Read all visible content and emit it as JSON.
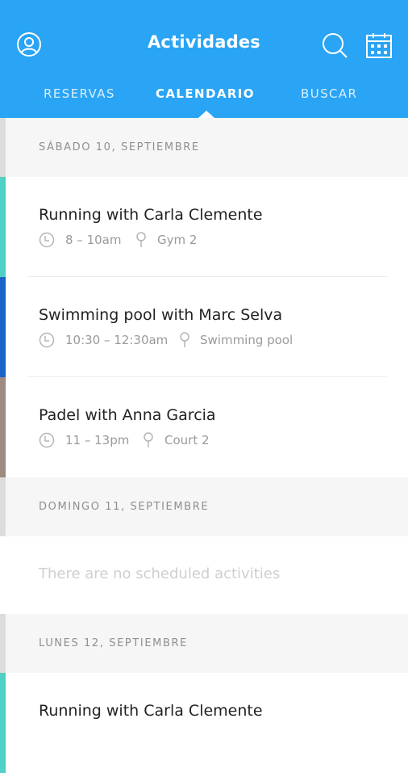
{
  "header": {
    "title": "Actividades",
    "icons": [
      "profile-icon",
      "search-icon",
      "calendar-icon"
    ]
  },
  "tabs": [
    {
      "label": "RESERVAS",
      "active": false
    },
    {
      "label": "CALENDARIO",
      "active": true
    },
    {
      "label": "BUSCAR",
      "active": false
    }
  ],
  "days": [
    {
      "label": "SÁBADO 10, SEPTIEMBRE",
      "activities": [
        {
          "name_prefix": "Running with ",
          "instructor": "Carla Clemente",
          "time": "8 – 10am",
          "place": "Gym 2",
          "color": "#4fd1c5"
        },
        {
          "name_prefix": "Swimming pool with ",
          "instructor": "Marc Selva",
          "time": "10:30 – 12:30am",
          "place": "Swimming pool",
          "color": "#1a63c7"
        },
        {
          "name_prefix": "Padel with ",
          "instructor": "Anna Garcia",
          "time": "11 – 13pm",
          "place": "Court 2",
          "color": "#9e8a80"
        }
      ]
    },
    {
      "label": "DOMINGO 11, SEPTIEMBRE",
      "empty_text": "There are no scheduled activities"
    },
    {
      "label": "LUNES 12, SEPTIEMBRE",
      "activities": [
        {
          "name_prefix": "Running with ",
          "instructor": "Carla Clemente",
          "color": "#4fd1c5"
        }
      ]
    }
  ],
  "colors": {
    "header": "#2aa4f4",
    "day_header_bg": "#f6f6f6"
  }
}
